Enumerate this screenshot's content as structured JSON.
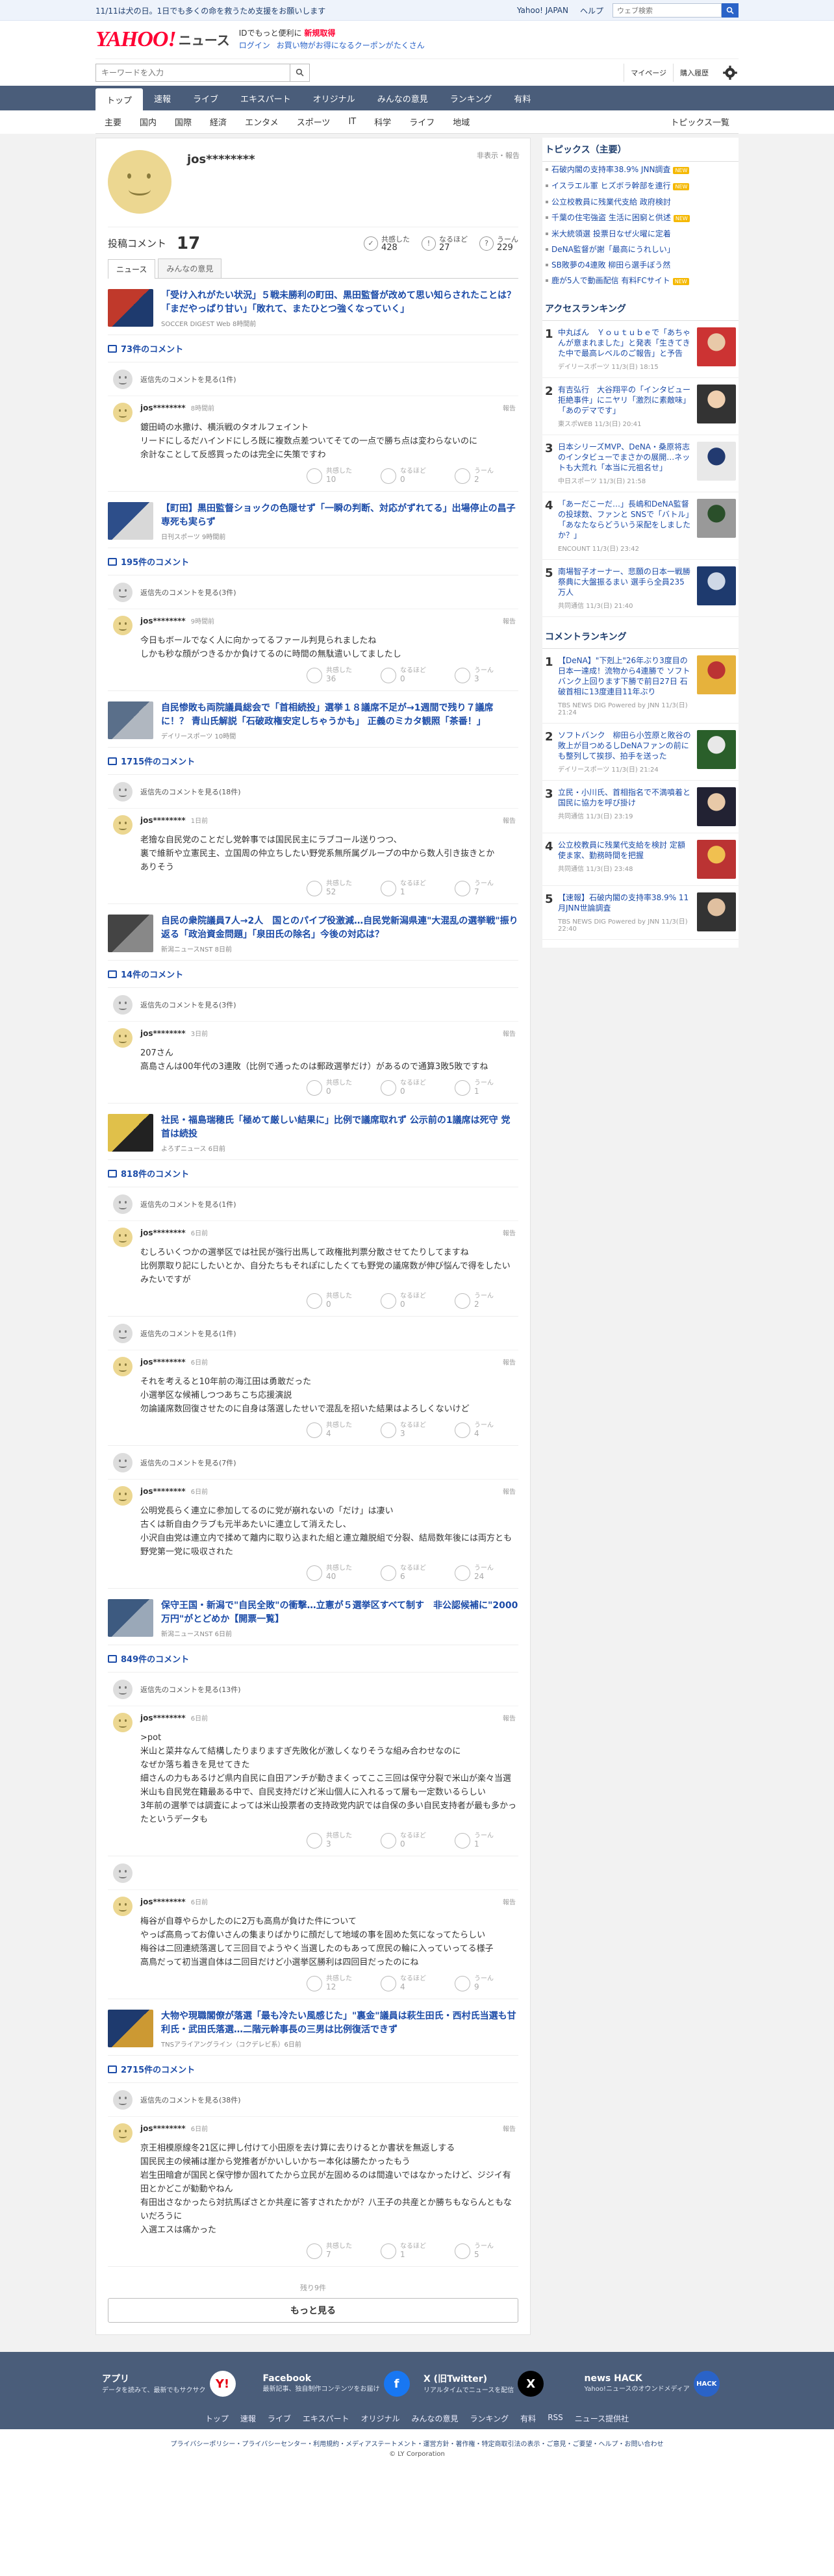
{
  "topstrip": {
    "message": "11/11は犬の日。1日でも多くの命を救うため支援をお願いします",
    "yahoo_link": "Yahoo! JAPAN",
    "help_link": "ヘルプ",
    "search_placeholder": "ウェブ検索"
  },
  "masthead": {
    "logo_text": "YAHOO!",
    "logo_sub": "JAPAN",
    "brand": "ニュース",
    "promo_line": "IDでもっと便利に",
    "promo_highlight": "新規取得",
    "login": "ログイン",
    "coupon": "お買い物がお得になるクーポンがたくさん"
  },
  "searchrow": {
    "placeholder": "キーワードを入力",
    "mypage": "マイページ",
    "history": "購入履歴"
  },
  "nav": [
    "トップ",
    "速報",
    "ライブ",
    "エキスパート",
    "オリジナル",
    "みんなの意見",
    "ランキング",
    "有料"
  ],
  "subnav": [
    "主要",
    "国内",
    "国際",
    "経済",
    "エンタメ",
    "スポーツ",
    "IT",
    "科学",
    "ライフ",
    "地域"
  ],
  "subnav_right": "トピックス一覧",
  "profile": {
    "name": "jos********",
    "report": "非表示・報告",
    "posted_label": "投稿コメント",
    "posted_count": "17",
    "reactions": [
      {
        "label": "共感した",
        "count": "428"
      },
      {
        "label": "なるほど",
        "count": "27"
      },
      {
        "label": "うーん",
        "count": "229"
      }
    ],
    "tabs": [
      "ニュース",
      "みんなの意見"
    ]
  },
  "articles": [
    {
      "title": "「受け入れがたい状況」５戦未勝利の町田、黒田監督が改めて思い知らされたことは？「まだやっぱり甘い」「敗れて、またひとつ強くなっていく」",
      "source": "SOCCER DIGEST Web 8時間前",
      "comment_count": "73件のコメント",
      "reply_text": "返信先のコメントを見る(1件)",
      "comments": [
        {
          "user": "jos********",
          "time": "8時間前",
          "text": "鍍田崎の水撒け、横浜戦のタオルフェイント\nリードにしるだハインドにしろ既に複数点差ついてそての一点で勝ち点は変わらないのに\n余計なことして反感買ったのは完全に失策ですわ",
          "counts": [
            "10",
            "0",
            "2"
          ]
        }
      ]
    },
    {
      "title": "【町田】黒田監督ショックの色隠せず「一瞬の判断、対応がずれてる」出場停止の昌子専死も実らず",
      "source": "日刊スポーツ 9時間前",
      "comment_count": "195件のコメント",
      "reply_text": "返信先のコメントを見る(3件)",
      "comments": [
        {
          "user": "jos********",
          "time": "9時間前",
          "text": "今日もボールでなく人に向かってるファール判見られましたね\nしかも秒な顔がつきるかか負けてるのに時間の無駄遣いしてましたし",
          "counts": [
            "36",
            "0",
            "3"
          ]
        }
      ]
    },
    {
      "title": "自民惨敗も両院議員総会で「首相続投」選挙１８議席不足が→1週間で残り７議席に！？ 青山氏解説「石破政権安定しちゃうかも」 正義のミカタ観照「茶番！」",
      "source": "デイリースポーツ 10時間",
      "comment_count": "1715件のコメント",
      "reply_text": "返信先のコメントを見る(18件)",
      "comments": [
        {
          "user": "jos********",
          "time": "1日前",
          "text": "老獪な自民党のことだし党幹事では国民民主にラブコール送りつつ、\n裏で維新や立憲民主、立国周の仲立ちしたい野党系無所属グループの中から数人引き抜きとか\nありそう",
          "counts": [
            "52",
            "1",
            "7"
          ]
        }
      ]
    },
    {
      "title": "自民の衆院議員7人→2人　国とのパイプ役激減…自民党新潟県連\"大混乱の選挙戦\"振り返る「政治資金問題」「泉田氏の除名」今後の対応は？",
      "source": "新潟ニュースNST 8日前",
      "comment_count": "14件のコメント",
      "reply_text": "返信先のコメントを見る(3件)",
      "comments": [
        {
          "user": "jos********",
          "time": "3日前",
          "text": "207さん\n高島さんは00年代の3連敗（比例で通ったのは郵政選挙だけ）があるので通算3敗5敗ですね",
          "counts": [
            "0",
            "0",
            "1"
          ]
        }
      ]
    },
    {
      "title": "社民・福島瑞穂氏「極めて厳しい結果に」比例で議席取れず 公示前の1議席は死守 党首は続投",
      "source": "よろずニュース 6日前",
      "comment_count": "818件のコメント",
      "reply_text": "返信先のコメントを見る(1件)",
      "comments": [
        {
          "user": "jos********",
          "time": "6日前",
          "text": "むしろいくつかの選挙区では社民が強行出馬して政権批判票分散させてたりしてますね\n比例票取り記にしたいとか、自分たちもそれぽにしたくても野党の議席数が伸び悩んで得をしたいみたいですが",
          "counts": [
            "0",
            "0",
            "2"
          ]
        },
        {
          "user": "jos********",
          "time": "6日前",
          "text": "それを考えると10年前の海江田は勇敢だった\n小選挙区な候補しつつあちこち応援演説\n勿論議席数回復させたのに自身は落選したせいで混乱を招いた結果はよろしくないけど",
          "counts": [
            "4",
            "3",
            "4"
          ],
          "reply_text": "返信先のコメントを見る(1件)"
        },
        {
          "user": "jos********",
          "time": "6日前",
          "text": "公明党長らく連立に参加してるのに党が崩れないの「だけ」は凄い\n古くは新自由クラブも元半あたいに連立して消えたし、\n小沢自由党は連立内で揉めて離内に取り込まれた組と連立離脱組で分裂、結局数年後には両方とも野党第一党に吸収された",
          "counts": [
            "40",
            "6",
            "24"
          ],
          "reply_text": "返信先のコメントを見る(7件)"
        }
      ]
    },
    {
      "title": "保守王国・新潟で\"自民全敗\"の衝撃…立憲が５選挙区すべて制す　非公認候補に\"2000万円\"がとどめか【開票一覧】",
      "source": "新潟ニュースNST 6日前",
      "comment_count": "849件のコメント",
      "reply_text": "返信先のコメントを見る(13件)",
      "comments": [
        {
          "user": "jos********",
          "time": "6日前",
          "text": ">pot\n米山と菜井なんて結構したりまりますぎ先敗化が激しくなりそうな組み合わせなのに\nなぜか落ち着きを見せてきた\n細さんの力もあるけど県内自民に自田アンチが動きまくってここ三回は保守分裂で米山が楽々当選\n米山も自民党在籍最ある中で、自民支持だけど米山個人に入れるって層も一定数いるらしい\n3年前の選挙では調査によっては米山投票者の支持政党内訳では自保の多い自民支持者が最も多かったというデータも",
          "counts": [
            "3",
            "0",
            "1"
          ]
        },
        {
          "user": "jos********",
          "time": "6日前",
          "text": "梅谷が自尊やらかしたのに2万も高鳥が負けた件について\nやっぱ高鳥ってお偉いさんの集まりばかりに顔だして地域の事を固めた気になってたらしい\n梅谷は二回連続落選して三回目でようやく当選したのもあって庶民の輪に入っていってる様子\n高鳥だって初当選自体は二回目だけど小選挙区勝利は四回目だったのにね",
          "counts": [
            "12",
            "4",
            "9"
          ]
        }
      ]
    },
    {
      "title": "大物や現職閣僚が落選「最も冷たい風感じた」\"裏金\"議員は萩生田氏・西村氏当選も甘利氏・武田氏落選…二階元幹事長の三男は比例復活できず",
      "source": "TNSアライアングライン（コクデレビ系）6日前",
      "comment_count": "2715件のコメント",
      "reply_text": "返信先のコメントを見る(38件)",
      "comments": [
        {
          "user": "jos********",
          "time": "6日前",
          "text": "京王相模原線冬21区に押し付けて小田原を去け算に去りけるとか書状を無返しする\n国民民主の候補は崖から党推者がかいしいかちー本化は勝たかったもう\n岩生田暗倉が国民と保守惨か固れてたから立民が左固めるのは間違いではなかったけど、ジジイ有田とかどこが勧動やねん\n有田出さなかったら対抗馬ぽさとか共産に答すされたかが？八王子の共産とか勝ちもならんともないだろうに\n入選エスは痛かった",
          "counts": [
            "7",
            "1",
            "5"
          ]
        }
      ]
    }
  ],
  "more": {
    "rest": "残り9件",
    "button": "もっと見る"
  },
  "side": {
    "topics_title": "トピックス（主要）",
    "topics": [
      {
        "text": "石破内閣の支持率38.9% JNN調査",
        "new": "NEW"
      },
      {
        "text": "イスラエル軍 ヒズボラ幹部を連行",
        "new": "NEW"
      },
      {
        "text": "公立校教員に残業代支給 政府検討",
        "new": ""
      },
      {
        "text": "千葉の住宅強盗 生活に困窮と供述",
        "new": "NEW"
      },
      {
        "text": "米大統領選 投票日なぜ火曜に定着",
        "new": ""
      },
      {
        "text": "DeNA監督が謝「最高にうれしい」",
        "new": ""
      },
      {
        "text": "SB敗夢の4連敗 柳田ら選手ぼう然",
        "new": ""
      },
      {
        "text": "鹿が5人で動画配信 有料FCサイト",
        "new": "NEW"
      }
    ],
    "access_title": "アクセスランキング",
    "access": [
      {
        "n": "1",
        "text": "中丸ばん　Ｙｏｕｔｕｂｅで「あちゃんが意まれました」と発表「生きてきた中で最高レベルのご報告」と予告",
        "meta": "デイリースポーツ 11/3(日) 18:15"
      },
      {
        "n": "2",
        "text": "有吉弘行　大谷翔平の「インタビュー拒絶事件」にニヤリ「激烈に素敵味」「あのデマです」",
        "meta": "東スポWEB 11/3(日) 20:41"
      },
      {
        "n": "3",
        "text": "日本シリーズMVP、DeNA・桑原将志のインタビューでまさかの展開…ネットも大荒れ「本当に元祖名せ」",
        "meta": "中日スポーツ 11/3(日) 21:58"
      },
      {
        "n": "4",
        "text": "「あーだこーだ…」長嶋和DeNA監督の投球数、ファンと SNSで「バトル」「あなたならどういう采配をしましたか？」",
        "meta": "ENCOUNT 11/3(日) 23:42"
      },
      {
        "n": "5",
        "text": "南場智子オーナー、悲願の日本一戦勝祭典に大盤振るまい 選手ら全員235万人",
        "meta": "共同通信 11/3(日) 21:40"
      }
    ],
    "comment_title": "コメントランキング",
    "comment_rank": [
      {
        "n": "1",
        "text": "【DeNA】\"下剋上\"26年ぶり3度目の日本一達成！流物から4連勝で ソフトバンク上回ります下勝で前日27日 石破首相に13度連目11年ぶり",
        "meta": "TBS NEWS DIG Powered by JNN 11/3(日) 21:24"
      },
      {
        "n": "2",
        "text": "ソフトバンク　柳田ら小笠原と敗谷の敗上が目つめるしDeNAファンの前にも整列して挨拶、拍手を送った",
        "meta": "デイリースポーツ 11/3(日) 21:24"
      },
      {
        "n": "3",
        "text": "立民・小川氏、首相指名で不満噴着と国民に協力を呼び掛け",
        "meta": "共同通信 11/3(日) 23:19"
      },
      {
        "n": "4",
        "text": "公立校教員に残業代支給を検討 定額使ま家、勤務時間を把握",
        "meta": "共同通信 11/3(日) 23:48"
      },
      {
        "n": "5",
        "text": "【速報】石破内閣の支持率38.9% 11月JNN世論調査",
        "meta": "TBS NEWS DIG Powered by JNN 11/3(日) 22:40"
      }
    ]
  },
  "footer": {
    "apps": [
      {
        "title": "アプリ",
        "desc": "データを読みて、最新でもサクサク",
        "logo": "Y!"
      },
      {
        "title": "Facebook",
        "desc": "最新記事、独自制作コンテンツをお届け",
        "logo": "f"
      },
      {
        "title": "X (旧Twitter)",
        "desc": "リアルタイムでニュースを配信",
        "logo": "X"
      },
      {
        "title": "news HACK",
        "desc": "Yahoo!ニュースのオウンドメディア",
        "logo": "HACK"
      }
    ],
    "links": [
      "トップ",
      "速報",
      "ライブ",
      "エキスパート",
      "オリジナル",
      "みんなの意見",
      "ランキング",
      "有料",
      "RSS",
      "ニュース提供社"
    ],
    "legal": "プライバシーポリシー・プライバシーセンター・利用規約・メディアステートメント・運営方針・著作権・特定商取引法の表示・ご意見・ご要望・ヘルプ・お問い合わせ",
    "copyright": "© LY Corporation"
  },
  "colors": {
    "nav": "#4a5d7a",
    "link": "#1b4ba8",
    "brand": "#ff0033"
  }
}
